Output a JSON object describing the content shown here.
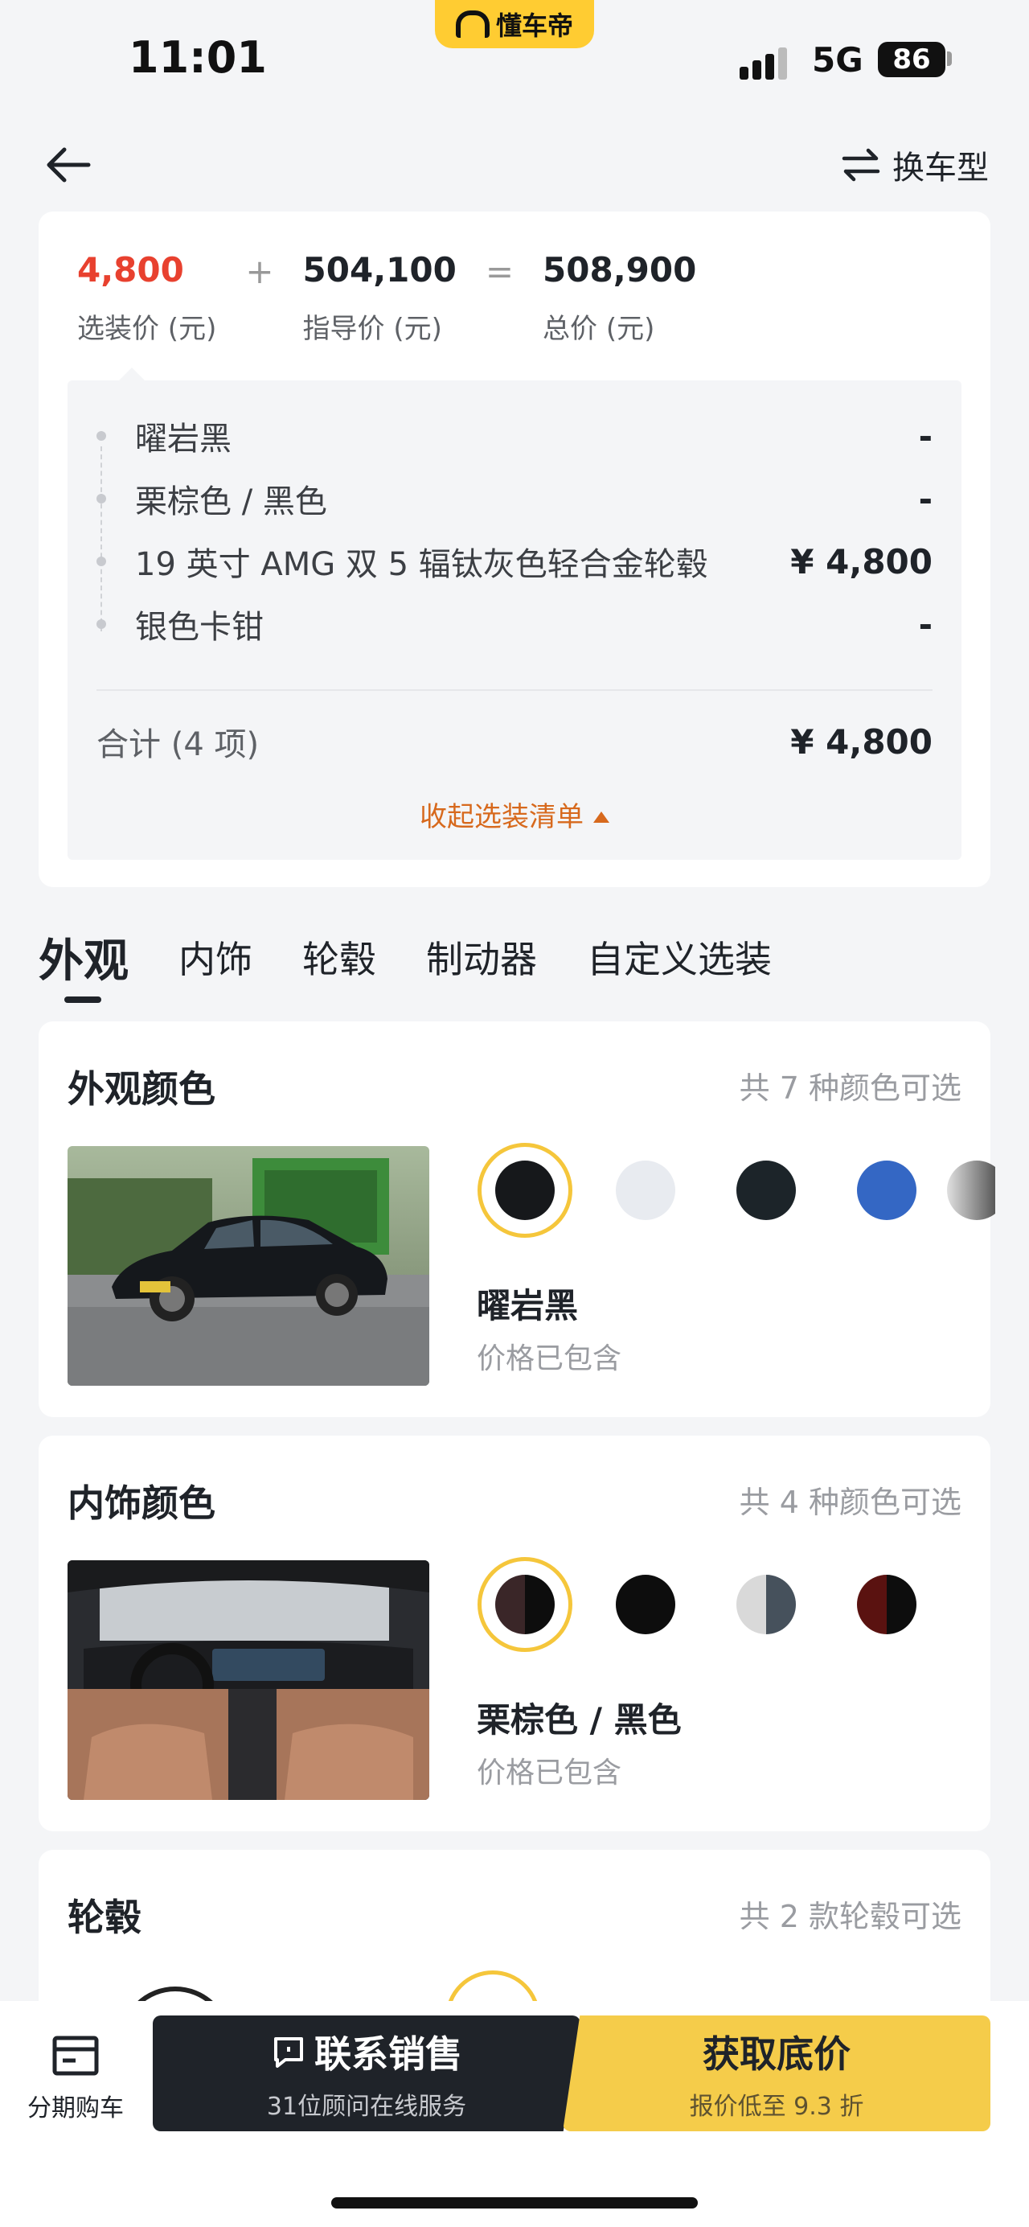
{
  "status_bar": {
    "time": "11:01",
    "brand": "懂车帝",
    "network": "5G",
    "battery": "86"
  },
  "nav": {
    "switch_label": "换车型"
  },
  "price_summary": {
    "option_price": "4,800",
    "option_label": "选装价 (元)",
    "plus": "+",
    "guide_price": "504,100",
    "guide_label": "指导价 (元)",
    "equals": "=",
    "total_price": "508,900",
    "total_label": "总价 (元)"
  },
  "options": {
    "items": [
      {
        "name": "曜岩黑",
        "price": "-"
      },
      {
        "name": "栗棕色 / 黑色",
        "price": "-"
      },
      {
        "name": "19 英寸 AMG 双 5 辐钛灰色轻合金轮毂",
        "price": "¥ 4,800"
      },
      {
        "name": "银色卡钳",
        "price": "-"
      }
    ],
    "total_label": "合计 (4 项)",
    "total_price": "¥ 4,800",
    "collapse_label": "收起选装清单"
  },
  "tabs": [
    {
      "label": "外观",
      "active": true
    },
    {
      "label": "内饰",
      "active": false
    },
    {
      "label": "轮毂",
      "active": false
    },
    {
      "label": "制动器",
      "active": false
    },
    {
      "label": "自定义选装",
      "active": false
    }
  ],
  "exterior": {
    "title": "外观颜色",
    "count": "共 7 种颜色可选",
    "selected_name": "曜岩黑",
    "selected_note": "价格已包含",
    "swatches": [
      "#16181b",
      "#e8ebf0",
      "#1c2429",
      "#3467c4",
      "#808080"
    ]
  },
  "interior": {
    "title": "内饰颜色",
    "count": "共 4 种颜色可选",
    "selected_name": "栗棕色 / 黑色",
    "selected_note": "价格已包含"
  },
  "wheels": {
    "title": "轮毂",
    "count": "共 2 款轮毂可选"
  },
  "bottom_bar": {
    "finance_label": "分期购车",
    "contact_label": "联系销售",
    "contact_sub": "31位顾问在线服务",
    "getprice_label": "获取底价",
    "getprice_sub": "报价低至 9.3 折"
  },
  "colors": {
    "accent_red": "#e8412f",
    "accent_orange": "#d7691d",
    "brand_yellow": "#ffcc32",
    "selected_ring": "#f5c63b"
  }
}
